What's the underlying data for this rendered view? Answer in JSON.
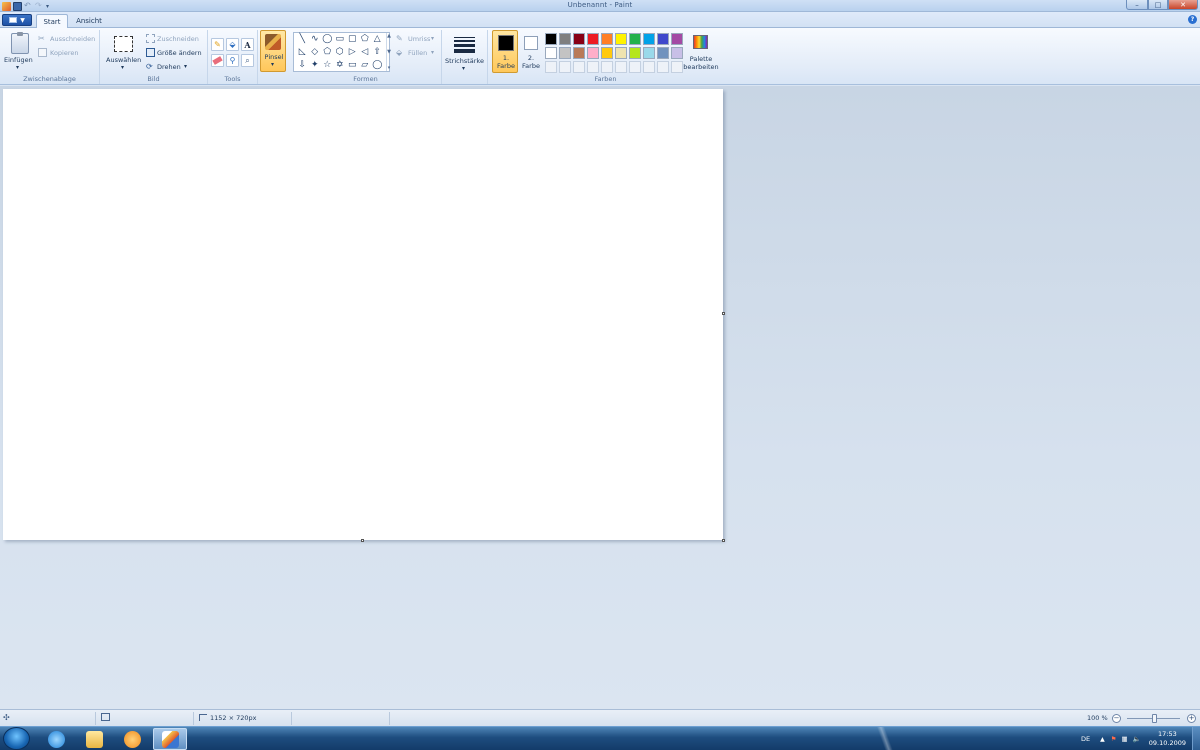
{
  "window": {
    "title": "Unbenannt - Paint"
  },
  "window_controls": {
    "minimize": "–",
    "maximize": "□",
    "close": "✕"
  },
  "tabs": {
    "start": "Start",
    "view": "Ansicht"
  },
  "clipboard": {
    "paste": "Einfügen",
    "cut": "Ausschneiden",
    "copy": "Kopieren",
    "group": "Zwischenablage"
  },
  "image": {
    "select": "Auswählen",
    "crop": "Zuschneiden",
    "resize": "Größe ändern",
    "rotate": "Drehen",
    "group": "Bild"
  },
  "tools": {
    "group": "Tools",
    "text_glyph": "A"
  },
  "brush": {
    "label": "Pinsel"
  },
  "shapes": {
    "rows": [
      [
        "╲",
        "∿",
        "◯",
        "▭",
        "▢",
        "⬠",
        "△"
      ],
      [
        "◺",
        "◇",
        "⬠",
        "⬡",
        "▷",
        "◁",
        "⇧"
      ],
      [
        "⇩",
        "✦",
        "☆",
        "✡",
        "▭",
        "▱",
        "◯"
      ]
    ],
    "outline": "Umriss",
    "fill": "Füllen",
    "group": "Formen"
  },
  "size": {
    "label": "Strichstärke"
  },
  "colors": {
    "color1_label": "1.\nFarbe",
    "color1_line1": "1.",
    "color1_line2": "Farbe",
    "color2_line1": "2.",
    "color2_line2": "Farbe",
    "color1": "#000000",
    "color2": "#ffffff",
    "palette_row1": [
      "#000000",
      "#7f7f7f",
      "#880015",
      "#ed1c24",
      "#ff7f27",
      "#fff200",
      "#22b14c",
      "#00a2e8",
      "#3f48cc",
      "#a349a4"
    ],
    "palette_row2": [
      "#ffffff",
      "#c3c3c3",
      "#b97a57",
      "#ffaec9",
      "#ffc90e",
      "#efe4b0",
      "#b5e61d",
      "#99d9ea",
      "#7092be",
      "#c8bfe7"
    ],
    "edit_line1": "Palette",
    "edit_line2": "bearbeiten",
    "group": "Farben"
  },
  "statusbar": {
    "image_size": "1152 × 720px",
    "zoom": "100 %"
  },
  "taskbar": {
    "language": "DE",
    "time": "17:53",
    "date": "09.10.2009"
  }
}
